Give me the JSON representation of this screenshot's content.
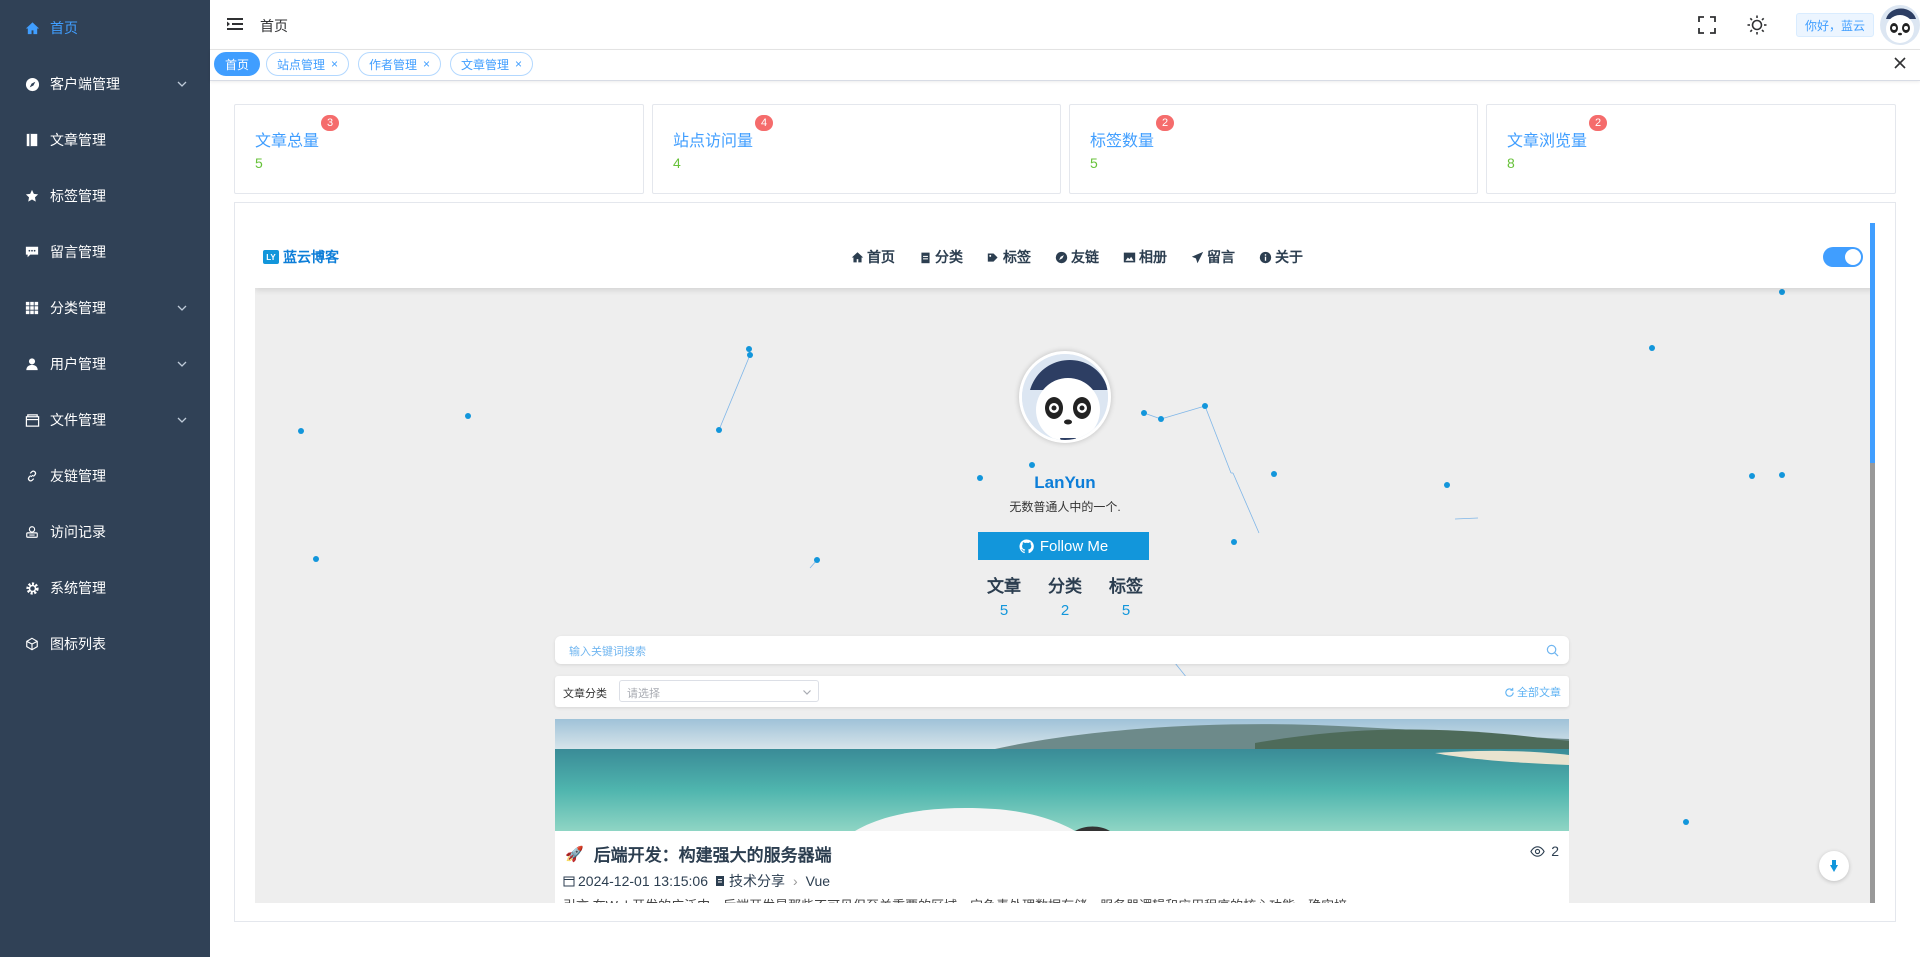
{
  "sidebar": {
    "items": [
      {
        "label": "首页",
        "icon": "home-icon",
        "active": true
      },
      {
        "label": "客户端管理",
        "icon": "compass-icon",
        "expandable": true
      },
      {
        "label": "文章管理",
        "icon": "book-icon"
      },
      {
        "label": "标签管理",
        "icon": "star-icon"
      },
      {
        "label": "留言管理",
        "icon": "comment-icon"
      },
      {
        "label": "分类管理",
        "icon": "grid-icon",
        "expandable": true
      },
      {
        "label": "用户管理",
        "icon": "user-icon",
        "expandable": true
      },
      {
        "label": "文件管理",
        "icon": "folder-icon",
        "expandable": true
      },
      {
        "label": "友链管理",
        "icon": "link-icon"
      },
      {
        "label": "访问记录",
        "icon": "record-icon"
      },
      {
        "label": "系统管理",
        "icon": "gear-icon"
      },
      {
        "label": "图标列表",
        "icon": "cube-icon"
      }
    ]
  },
  "header": {
    "breadcrumb": "首页",
    "greeting": "你好，蓝云"
  },
  "tags": [
    {
      "label": "首页",
      "active": true
    },
    {
      "label": "站点管理"
    },
    {
      "label": "作者管理"
    },
    {
      "label": "文章管理"
    }
  ],
  "cards": [
    {
      "title": "文章总量",
      "badge": "3",
      "value": "5"
    },
    {
      "title": "站点访问量",
      "badge": "4",
      "value": "4"
    },
    {
      "title": "标签数量",
      "badge": "2",
      "value": "5"
    },
    {
      "title": "文章浏览量",
      "badge": "2",
      "value": "8"
    }
  ],
  "blog": {
    "brand": "蓝云博客",
    "brand_logo": "LY",
    "menu": [
      {
        "label": "首页",
        "icon": "home-icon"
      },
      {
        "label": "分类",
        "icon": "clipboard-icon"
      },
      {
        "label": "标签",
        "icon": "tags-icon"
      },
      {
        "label": "友链",
        "icon": "compass-icon"
      },
      {
        "label": "相册",
        "icon": "image-icon"
      },
      {
        "label": "留言",
        "icon": "send-icon"
      },
      {
        "label": "关于",
        "icon": "info-icon"
      }
    ],
    "profile": {
      "name": "LanYun",
      "motto": "无数普通人中的一个.",
      "follow": "Follow Me",
      "stats": [
        {
          "label": "文章",
          "value": "5"
        },
        {
          "label": "分类",
          "value": "2"
        },
        {
          "label": "标签",
          "value": "5"
        }
      ]
    },
    "search_placeholder": "输入关键词搜索",
    "filter": {
      "label": "文章分类",
      "placeholder": "请选择",
      "all": "全部文章"
    },
    "article": {
      "title": "后端开发：构建强大的服务器端",
      "views": "2",
      "date": "2024-12-01 13:15:06",
      "category": "技术分享",
      "tag": "Vue",
      "excerpt": "引言 在Web开发的广泛中，后端开发是那些不可见但至关重要的区域。它负责处理数据存储、服务器逻辑和应用程序的核心功能，确实培"
    }
  },
  "colors": {
    "sidebar_bg": "#304156",
    "accent": "#409eff",
    "badge": "#f56c6c",
    "value": "#67c23a",
    "blog_blue": "#1296db"
  }
}
